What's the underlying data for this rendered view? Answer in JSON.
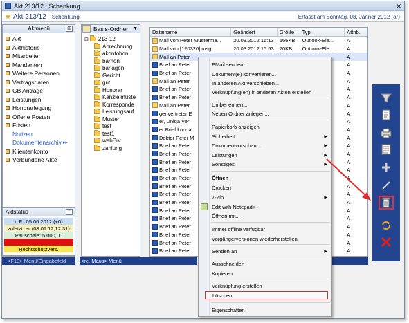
{
  "window": {
    "title": "Akt 213/12 : Schenkung",
    "close_glyph": "✕"
  },
  "header": {
    "akt": "Akt 213/12",
    "subject": "Schenkung",
    "erfasst": "Erfasst am Sonntag, 08. Jänner 2012 (ar)"
  },
  "aktmenu": {
    "title": "Aktmenü",
    "items": [
      {
        "label": "Akt"
      },
      {
        "label": "Akthistorie"
      },
      {
        "label": "Mitarbeiter"
      },
      {
        "label": "Mandanten"
      },
      {
        "label": "Weitere Personen"
      },
      {
        "label": "Vertragsdaten"
      },
      {
        "label": "GB Anträge"
      },
      {
        "label": "Leistungen"
      },
      {
        "label": "Honorarlegung"
      },
      {
        "label": "Offene Posten"
      },
      {
        "label": "Fristen"
      },
      {
        "label": "Notizen"
      },
      {
        "label": "Dokumentenarchiv"
      },
      {
        "label": "Klientenkonto"
      },
      {
        "label": "Verbundene Akte"
      }
    ]
  },
  "aktstatus": {
    "title": "Aktstatus",
    "rows": [
      "n.F.: 05.06.2012 (+0)",
      "zuletzt: ar (08.01.12;12:31)",
      "Pauschale: 5.000,00",
      "Fremdgeld: 0,00",
      "Rechtschutzvers."
    ]
  },
  "footer": {
    "left": "<F10> Menü/Eingabefeld",
    "mid": "<re. Maus> Menü"
  },
  "tree": {
    "dropdown": "Basis-Ordner",
    "root": "213-12",
    "nodes": [
      "Abrechnung",
      "akontohon",
      "barhon",
      "barlagen",
      "Gericht",
      "gut",
      "Honorar",
      "Kanzleimuste",
      "Korresponde",
      "Leistungsauf",
      "Muster",
      "test",
      "test1",
      "webErv",
      "zahlung"
    ]
  },
  "files": {
    "columns": [
      "Dateiname",
      "Geändert",
      "Größe",
      "Typ",
      "Attrib."
    ],
    "rows": [
      {
        "icon": "msg",
        "name": "Mail von Peter Musterma...",
        "date": "20.03.2012 16:13",
        "size": "166KB",
        "type": "Outlook-Ele...",
        "attr": "A"
      },
      {
        "icon": "msg",
        "name": "Mail von [120320].msg",
        "date": "20.03.2012 15:53",
        "size": "70KB",
        "type": "Outlook-Ele...",
        "attr": "A"
      },
      {
        "icon": "msg",
        "name": "Mail an Peter",
        "date": "",
        "size": "",
        "type": "",
        "attr": "A"
      },
      {
        "icon": "doc",
        "name": "Brief an Peter",
        "date": "",
        "size": "",
        "type": "",
        "attr": "A"
      },
      {
        "icon": "doc",
        "name": "Brief an Peter",
        "date": "",
        "size": "",
        "type": "",
        "attr": "A"
      },
      {
        "icon": "msg",
        "name": "Mail an Peter",
        "date": "",
        "size": "",
        "type": "",
        "attr": "A"
      },
      {
        "icon": "doc",
        "name": "Brief an Peter",
        "date": "",
        "size": "",
        "type": "",
        "attr": "A"
      },
      {
        "icon": "doc",
        "name": "Brief an Peter",
        "date": "",
        "size": "",
        "type": "",
        "attr": "A"
      },
      {
        "icon": "msg",
        "name": "Mail an Peter",
        "date": "",
        "size": "",
        "type": "",
        "attr": "A"
      },
      {
        "icon": "doc",
        "name": "genvertreter E",
        "date": "",
        "size": "",
        "type": "",
        "attr": "A"
      },
      {
        "icon": "doc",
        "name": "er, Uniqa Ver",
        "date": "",
        "size": "",
        "type": "",
        "attr": "A"
      },
      {
        "icon": "doc",
        "name": "er Brief kurz a",
        "date": "",
        "size": "",
        "type": "",
        "attr": "A"
      },
      {
        "icon": "doc",
        "name": "Doktor Peter M",
        "date": "",
        "size": "",
        "type": "",
        "attr": "A"
      },
      {
        "icon": "doc",
        "name": "Brief an Peter",
        "date": "",
        "size": "",
        "type": "",
        "attr": "A"
      },
      {
        "icon": "doc",
        "name": "Brief an Peter",
        "date": "",
        "size": "",
        "type": "",
        "attr": "A"
      },
      {
        "icon": "doc",
        "name": "Brief an Peter",
        "date": "",
        "size": "",
        "type": "",
        "attr": "A"
      },
      {
        "icon": "doc",
        "name": "Brief an Peter",
        "date": "",
        "size": "",
        "type": "",
        "attr": "A"
      },
      {
        "icon": "doc",
        "name": "Brief an Peter",
        "date": "",
        "size": "",
        "type": "",
        "attr": "A"
      },
      {
        "icon": "doc",
        "name": "Brief an Peter",
        "date": "",
        "size": "",
        "type": "",
        "attr": "A"
      },
      {
        "icon": "doc",
        "name": "Brief an Peter",
        "date": "",
        "size": "",
        "type": "",
        "attr": "A"
      },
      {
        "icon": "doc",
        "name": "Brief an Peter",
        "date": "",
        "size": "",
        "type": "",
        "attr": "A"
      },
      {
        "icon": "doc",
        "name": "Brief an Peter",
        "date": "",
        "size": "",
        "type": "",
        "attr": "A"
      },
      {
        "icon": "doc",
        "name": "Brief an Peter",
        "date": "",
        "size": "",
        "type": "",
        "attr": "A"
      },
      {
        "icon": "doc",
        "name": "Brief an Peter",
        "date": "",
        "size": "",
        "type": "",
        "attr": "A"
      },
      {
        "icon": "doc",
        "name": "Brief an Peter",
        "date": "",
        "size": "",
        "type": "",
        "attr": "A"
      },
      {
        "icon": "doc",
        "name": "Brief an Peter",
        "date": "",
        "size": "",
        "type": "",
        "attr": "A"
      },
      {
        "icon": "doc",
        "name": "Brief an Peter",
        "date": "",
        "size": "",
        "type": "",
        "attr": "A"
      }
    ]
  },
  "context_menu": {
    "items": [
      {
        "label": "EMail senden...",
        "submenu": false
      },
      {
        "label": "Dokument(e) konvertieren...",
        "submenu": false
      },
      {
        "label": "In anderen Akt verschieben...",
        "submenu": false
      },
      {
        "label": "Verknüpfung(en) in anderen Akten erstellen",
        "submenu": false
      },
      {
        "label": "Umbenennen...",
        "submenu": false
      },
      {
        "label": "Neuen Ordner anlegen...",
        "submenu": false
      },
      {
        "label": "Papierkorb anzeigen",
        "submenu": false
      },
      {
        "label": "Sicherheit",
        "submenu": true
      },
      {
        "label": "Dokumentvorschau...",
        "submenu": true
      },
      {
        "label": "Leistungen",
        "submenu": true
      },
      {
        "label": "Sonstiges",
        "submenu": true
      },
      {
        "label": "Öffnen",
        "submenu": false
      },
      {
        "label": "Drucken",
        "submenu": false
      },
      {
        "label": "7-Zip",
        "submenu": true
      },
      {
        "label": "Edit with Notepad++",
        "submenu": false
      },
      {
        "label": "Öffnen mit...",
        "submenu": false
      },
      {
        "label": "Immer offline verfügbar",
        "submenu": false
      },
      {
        "label": "Vorgängerversionen wiederherstellen",
        "submenu": false
      },
      {
        "label": "Senden an",
        "submenu": true
      },
      {
        "label": "Ausschneiden",
        "submenu": false
      },
      {
        "label": "Kopieren",
        "submenu": false
      },
      {
        "label": "Verknüpfung erstellen",
        "submenu": false
      },
      {
        "label": "Löschen",
        "submenu": false
      },
      {
        "label": "Eigenschaften",
        "submenu": false
      }
    ]
  },
  "toolbar": {
    "icons": [
      "filter-icon",
      "new-document-icon",
      "print-icon",
      "document-list-icon",
      "plus-icon",
      "pencil-icon",
      "trash-icon",
      "refresh-icon",
      "delete-x-icon"
    ],
    "selected": "trash-icon"
  },
  "colors": {
    "accent": "#23458f",
    "highlight": "#d23030"
  }
}
